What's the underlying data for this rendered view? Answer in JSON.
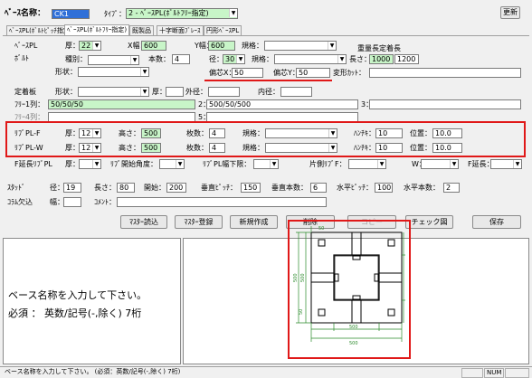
{
  "header": {
    "base_name_label": "ﾍﾞｰｽ名称：",
    "base_name_value": "CK1",
    "type_label": "ﾀｲﾌﾟ：",
    "type_value": "2 - ﾍﾞｰｽPL(ﾎﾞﾙﾄﾌﾘｰ指定)",
    "update_label": "更新"
  },
  "tabs": [
    "ﾍﾞｰｽPL(ﾎﾞﾙﾄﾋﾟｯﾁ指定)",
    "ﾍﾞｰｽPL(ﾎﾞﾙﾄﾌﾘｰ指定)",
    "既製品",
    "十字断面ﾌﾞﾚｰｽ",
    "円形ﾍﾞｰｽPL"
  ],
  "baseplate": {
    "label": "ﾍﾞｰｽPL",
    "thick_label": "厚：",
    "thick_value": "22",
    "xwidth_label": "X幅：",
    "xwidth_value": "600",
    "ywidth_label": "Y幅：",
    "ywidth_value": "600",
    "spec_label": "規格：",
    "spec_value": "",
    "weight_label": "重量長定着長"
  },
  "bolt": {
    "label": "ﾎﾞﾙﾄ",
    "type_label": "種別：",
    "type_value": "",
    "count_label": "本数：",
    "count_value": "4",
    "dia_label": "径：",
    "dia_value": "30",
    "spec_label": "規格：",
    "spec_value": "",
    "length_label": "長さ：",
    "length_value1": "1000",
    "length_value2": "1200",
    "shape_label": "形状：",
    "shape_value": "",
    "offset_x_label": "偏芯X：",
    "offset_x_value": "50",
    "offset_y_label": "偏芯Y：",
    "offset_y_value": "50",
    "deform_label": "変形ｶｯﾄ：",
    "deform_value": ""
  },
  "anchor": {
    "label": "定着板",
    "shape_label": "形状：",
    "shape_value": "",
    "thick_label": "厚：",
    "thick_value": "",
    "outer_label": "外径：",
    "outer_value": "",
    "inner_label": "内径：",
    "inner_value": ""
  },
  "free": {
    "row1_label": "ﾌﾘｰ1列：",
    "row1_v1": "50/50/50",
    "row1_n2": "2：",
    "row1_v2": "500/50/500",
    "row1_n3": "3：",
    "row1_v3": "",
    "row4_label": "ﾌﾘｰ4列：",
    "row4_n5": "5：",
    "row4_v5": ""
  },
  "rib_f": {
    "label": "ﾘﾌﾞPL-F",
    "thick_label": "厚：",
    "thick_value": "12",
    "height_label": "高さ：",
    "height_value": "500",
    "count_label": "枚数：",
    "count_value": "4",
    "spec_label": "規格：",
    "spec_value": "",
    "hanch_label": "ﾊﾝﾁｷ：",
    "hanch_value": "10",
    "pos_label": "位置：",
    "pos_value": "10.0"
  },
  "rib_w": {
    "label": "ﾘﾌﾞPL-W",
    "thick_label": "厚：",
    "thick_value": "12",
    "height_label": "高さ：",
    "height_value": "500",
    "count_label": "枚数：",
    "count_value": "4",
    "spec_label": "規格：",
    "spec_value": "",
    "hanch_label": "ﾊﾝﾁｷ：",
    "hanch_value": "10",
    "pos_label": "位置：",
    "pos_value": "10.0"
  },
  "ext": {
    "f_label": "F延長ﾘﾌﾞPL",
    "thick_label": "厚：",
    "open_label": "ﾘﾌﾞ開始角度：",
    "width_label": "ﾘﾌﾞPL幅下限：",
    "side_label": "片側ﾘﾌﾞF：",
    "w_label": "W：",
    "fext_label": "F延長："
  },
  "stud": {
    "label": "ｽﾀｯﾄﾞ",
    "dia_label": "径：",
    "dia_value": "19",
    "len_label": "長さ：",
    "len_value": "80",
    "start_label": "開始：",
    "start_value": "200",
    "vpitch_label": "垂直ﾋﾟｯﾁ：",
    "vpitch_value": "150",
    "vcount_label": "垂直本数：",
    "vcount_value": "6",
    "hpitch_label": "水平ﾋﾟｯﾁ：",
    "hpitch_value": "100",
    "hcount_label": "水平本数：",
    "hcount_value": "2"
  },
  "column": {
    "label": "ｺﾗﾑ欠込",
    "width_label": "幅：",
    "width_value": "",
    "comment_label": "ｺﾒﾝﾄ：",
    "comment_value": ""
  },
  "buttons": {
    "master_read": "ﾏｽﾀｰ読込",
    "master_reg": "ﾏｽﾀｰ登録",
    "new": "新規作成",
    "delete": "削除",
    "copy": "コピー",
    "check": "チェック図",
    "save": "保存"
  },
  "message": {
    "line1": "ベース名称を入力して下さい。",
    "line2": "必須 ： 英数/記号(-,除く) 7桁"
  },
  "drawing": {
    "dim_top": "500",
    "dim_bottom": "500",
    "dim_left": "500",
    "dim_right": "500",
    "dim_small_left": "50",
    "dim_small_top": "50"
  },
  "statusbar": {
    "text": "ベース名称を入力して下さい。 (必須：英数/記号(-,除く) 7桁)",
    "num": "NUM"
  },
  "colors": {
    "accent_green": "#c8f5c8",
    "highlight_red": "#e01818"
  }
}
